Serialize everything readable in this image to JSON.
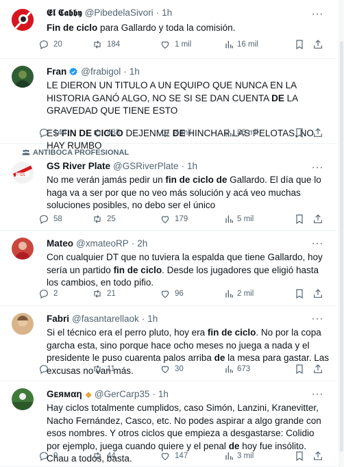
{
  "colors": {
    "text": "#0f1419",
    "secondary": "#536471",
    "border": "#eff3f4",
    "verified": "#1d9bf0"
  },
  "tweets": [
    {
      "name": "𝕰𝖑 𝕮𝖆𝖇𝖇𝖞",
      "handle": "@PibedelaSivori",
      "time": "1h",
      "body_parts": [
        [
          "Fin de ciclo",
          true
        ],
        [
          " para Gallardo y toda la comisión.",
          false
        ]
      ],
      "stats": {
        "replies": "20",
        "retweets": "184",
        "likes": "1 mil",
        "views": "16 mil"
      }
    },
    {
      "name": "Fran",
      "verified": true,
      "handle": "@frabigol",
      "time": "1h",
      "paragraphs": [
        [
          [
            "LE DIERON UN TITULO A UN EQUIPO QUE NUNCA EN LA HISTORIA GANÓ ALGO, NO SE SI SE DAN CUENTA ",
            false
          ],
          [
            "DE",
            true
          ],
          [
            " LA GRAVEDAD QUE TIENE ESTO",
            false
          ]
        ],
        [
          [
            "ES ",
            false
          ],
          [
            "FIN DE CICLO",
            true
          ],
          [
            " DEJENME ",
            false
          ],
          [
            "DE",
            true
          ],
          [
            " HINCHAR LAS PELOTAS, NO HAY RUMBO",
            false
          ]
        ]
      ],
      "stats": {
        "replies": "144",
        "retweets": "483",
        "likes": "4 mil",
        "views": "86 mil"
      }
    },
    {
      "social_context": "ANTIBOCA PROFESIONAL",
      "name": "GS River Plate",
      "handle": "@GSRiverPlate",
      "time": "1h",
      "body_parts": [
        [
          "No me verán jamás pedir un ",
          false
        ],
        [
          "fin de ciclo de",
          true
        ],
        [
          " Gallardo. El día que lo haga va a ser por que no veo más solución y acá veo muchas soluciones posibles, no debo ser el único",
          false
        ]
      ],
      "stats": {
        "replies": "58",
        "retweets": "25",
        "likes": "179",
        "views": "5 mil"
      }
    },
    {
      "name": "Mateo",
      "handle": "@xmateoRP",
      "time": "2h",
      "body_parts": [
        [
          "Con cualquier DT que no tuviera la espalda que tiene Gallardo, hoy sería un partido ",
          false
        ],
        [
          "fin de ciclo",
          true
        ],
        [
          ". Desde los jugadores que eligió hasta los cambios, en todo pifio.",
          false
        ]
      ],
      "stats": {
        "replies": "2",
        "retweets": "21",
        "likes": "96",
        "views": "2 mil"
      }
    },
    {
      "name": "Fabri",
      "handle": "@fasantarellaok",
      "time": "1h",
      "body_parts": [
        [
          "Si el técnico era el perro pluto, hoy era ",
          false
        ],
        [
          "fin de ciclo",
          true
        ],
        [
          ". No por la copa garcha esta, sino porque hace ocho meses no juega a nada y el presidente le puso cuarenta palos arriba ",
          false
        ],
        [
          "de",
          true
        ],
        [
          " la mesa para gastar. Las excusas no van más.",
          false
        ]
      ],
      "stats": {
        "replies": "",
        "retweets": "11",
        "likes": "30",
        "views": "673"
      }
    },
    {
      "name": "Gᴇямαη",
      "emoji": "🔸",
      "handle": "@GerCarp35",
      "time": "1h",
      "body_parts": [
        [
          "Hay ciclos totalmente cumplidos, caso Simón, Lanzini, Kranevitter, Nacho Fernández, Casco, etc. No podes aspirar a algo grande con esos nombres. Y otros ciclos que empieza a desgastarse: Colidio por ejemplo, juega cuando quiere y el penal ",
          false
        ],
        [
          "de",
          true
        ],
        [
          " hoy fue insólito. Chau a todos, basta.",
          false
        ]
      ],
      "stats": {
        "replies": "9",
        "retweets": "44",
        "likes": "147",
        "views": "3 mil"
      }
    }
  ]
}
